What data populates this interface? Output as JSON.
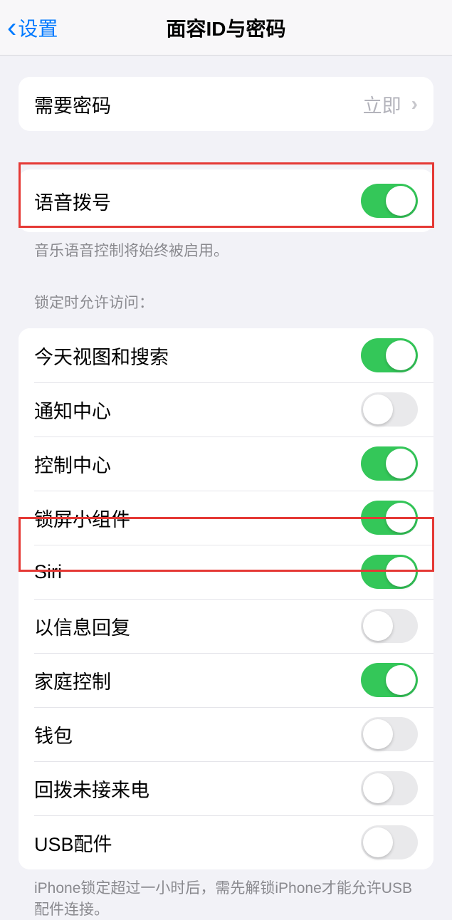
{
  "header": {
    "back_label": "设置",
    "title": "面容ID与密码"
  },
  "passcode_row": {
    "label": "需要密码",
    "value": "立即"
  },
  "voice_dial": {
    "label": "语音拨号",
    "on": true,
    "footer": "音乐语音控制将始终被启用。"
  },
  "lock_access": {
    "header": "锁定时允许访问：",
    "items": [
      {
        "label": "今天视图和搜索",
        "on": true
      },
      {
        "label": "通知中心",
        "on": false
      },
      {
        "label": "控制中心",
        "on": true
      },
      {
        "label": "锁屏小组件",
        "on": true
      },
      {
        "label": "Siri",
        "on": true
      },
      {
        "label": "以信息回复",
        "on": false
      },
      {
        "label": "家庭控制",
        "on": true
      },
      {
        "label": "钱包",
        "on": false
      },
      {
        "label": "回拨未接来电",
        "on": false
      },
      {
        "label": "USB配件",
        "on": false
      }
    ],
    "footer": "iPhone锁定超过一小时后，需先解锁iPhone才能允许USB配件连接。"
  }
}
